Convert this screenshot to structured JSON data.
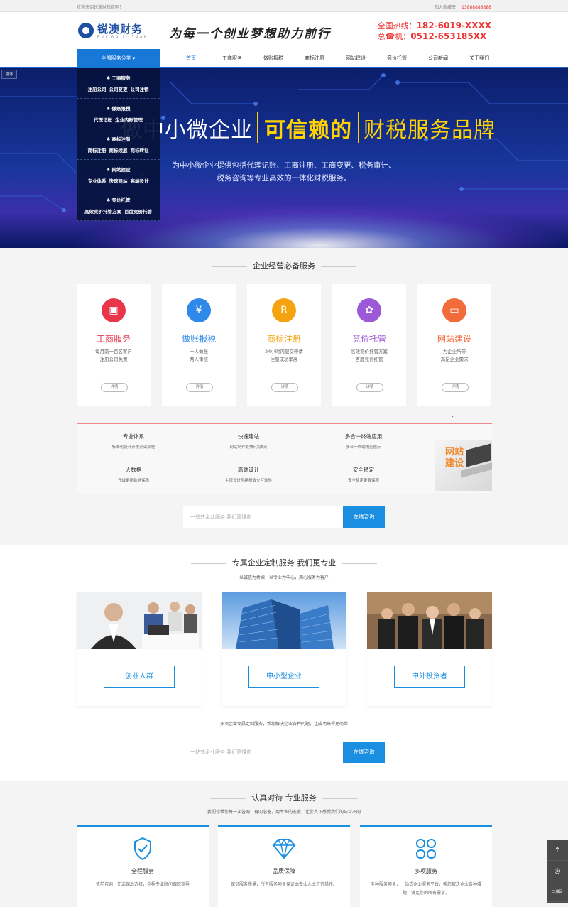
{
  "topbar": {
    "welcome": "欢迎来到锐澳财税官网！",
    "link_login": "加入收藏夹",
    "link_phone": "13888888888"
  },
  "header": {
    "logo_cn": "锐澳财务",
    "logo_en": "RUI AO JI TUAN",
    "slogan": "为每一个创业梦想助力前行",
    "hotline_label": "全国热线：",
    "hotline_number": "182-6019-XXXX",
    "phone_label": "总☎机：",
    "phone_number": "0512-653185XX"
  },
  "nav": {
    "all_services": "全部服务分类 ▾",
    "items": [
      "首页",
      "工商服务",
      "做账报税",
      "商标注册",
      "网站建设",
      "竞价托管",
      "公司新闻",
      "关于我们"
    ]
  },
  "dropdown": {
    "groups": [
      {
        "head": "工商服务",
        "links": [
          "注册公司",
          "公司变更",
          "公司注销"
        ]
      },
      {
        "head": "做账报税",
        "links": [
          "代理记账",
          "企业内账管理"
        ]
      },
      {
        "head": "商标注册",
        "links": [
          "商标注册",
          "商标续展",
          "商标转让"
        ]
      },
      {
        "head": "网站建设",
        "links": [
          "专业体系",
          "快速建站",
          "高端设计"
        ]
      },
      {
        "head": "竞价托管",
        "links": [
          "高效竞价托管方案",
          "百度竞价托管"
        ]
      }
    ]
  },
  "float_tag": "漂浮",
  "banner": {
    "title_a": "做中小微企业",
    "title_hl": "可信赖的",
    "title_c": "财税服务品牌",
    "desc_1": "为中小微企业提供包括代理记账、工商注册、工商变更、税务审计、",
    "desc_2": "税务咨询等专业高效的一体化财税服务。"
  },
  "section1": {
    "title": "企业经营必备服务",
    "cards": [
      {
        "title": "工商服务",
        "desc1": "每月前一百名客户",
        "desc2": "注册公司免费",
        "btn": "详情",
        "color": "#e8374a",
        "title_color": "#e8374a",
        "icon": "briefcase-icon"
      },
      {
        "title": "做账报税",
        "desc1": "一人做账",
        "desc2": "两人审核",
        "btn": "详情",
        "color": "#2f89e8",
        "title_color": "#2f89e8",
        "icon": "yen-icon"
      },
      {
        "title": "商标注册",
        "desc1": "24小时内提交申请",
        "desc2": "注册成功率高",
        "btn": "详情",
        "color": "#f5a30f",
        "title_color": "#f5a30f",
        "icon": "registered-icon"
      },
      {
        "title": "竞价托管",
        "desc1": "高效竞价托管方案",
        "desc2": "百度竞价托管",
        "btn": "详情",
        "color": "#9b59d8",
        "title_color": "#9b59d8",
        "icon": "bid-icon"
      },
      {
        "title": "网站建设",
        "desc1": "为企业所带",
        "desc2": "满足企业需求",
        "btn": "详情",
        "color": "#f26b3a",
        "title_color": "#f26b3a",
        "icon": "monitor-icon"
      }
    ]
  },
  "features": {
    "items": [
      {
        "t": "专业体系",
        "d": "标准化设计开发测试流程"
      },
      {
        "t": "快速建站",
        "d": "网站制作最快只需5天"
      },
      {
        "t": "多合一终端应用",
        "d": "多合一终端响应展示"
      },
      {
        "t": "大数据",
        "d": "升级更新数据保障"
      },
      {
        "t": "高端设计",
        "d": "主流设计风格极致交互体验"
      },
      {
        "t": "安全稳定",
        "d": "安全稳定更有保障"
      }
    ],
    "image_text_1": "网站",
    "image_text_2": "建设"
  },
  "search1": {
    "placeholder": "一站式企业服务 我们更懂你",
    "btn": "在线咨询"
  },
  "section2": {
    "title": "专属企业定制服务 我们更专业",
    "sub": "以诚信为桥梁，以专业为中心，用心服务为客户",
    "audiences": [
      "创业人群",
      "中小型企业",
      "中外投资者"
    ],
    "promo": "多项企业专属定制服务，帮您解决企业各种问题，让成功来得更简单"
  },
  "search2": {
    "placeholder": "一站式企业服务 我们更懂你",
    "btn": "在线咨询"
  },
  "section3": {
    "title": "认真对待 专业服务",
    "sub": "我们珍惜您每一次咨询，有问必答，用专业的态度，让您真正感受我们的与众不同",
    "items": [
      {
        "t": "全程服务",
        "d": "售前咨询，先选保后选择，全程专业顾问跟踪指导",
        "icon": "shield-check-icon"
      },
      {
        "t": "品质保障",
        "d": "保证服务质量，所有服务项目保证由专业人士进行操作。",
        "icon": "diamond-icon"
      },
      {
        "t": "多项服务",
        "d": "多种服务项目，一站式企业服务平台，帮您解决企业各种难题，满足您的所有需求。",
        "icon": "clover-icon"
      }
    ]
  },
  "sidebar": {
    "top": "↑",
    "wechat": "◎",
    "qr": "二维码"
  }
}
